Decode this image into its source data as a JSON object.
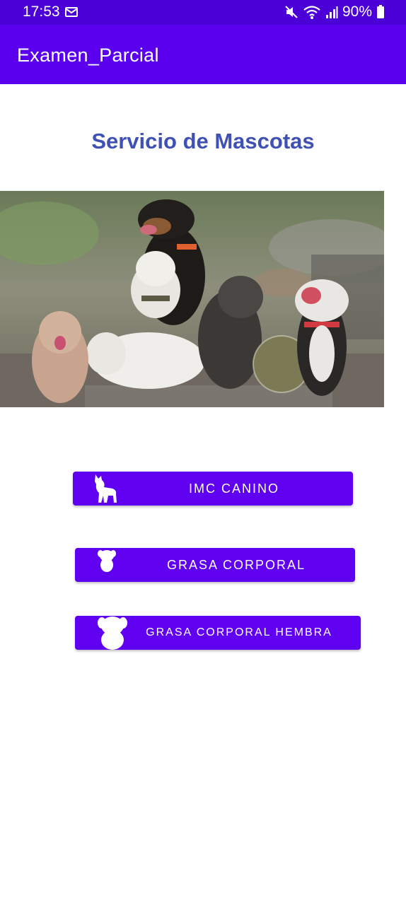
{
  "status_bar": {
    "time": "17:53",
    "battery_percent": "90%",
    "icons": [
      "notification-icon",
      "mute-icon",
      "wifi-icon",
      "signal-icon",
      "battery-icon"
    ]
  },
  "app_bar": {
    "title": "Examen_Parcial"
  },
  "main": {
    "title": "Servicio de Mascotas",
    "hero_image_alt": "dogs-photo",
    "buttons": [
      {
        "label": "IMC CANINO",
        "icon": "dog-silhouette-icon"
      },
      {
        "label": "GRASA CORPORAL",
        "icon": "puppy-silhouette-icon"
      },
      {
        "label": "GRASA CORPORAL HEMBRA",
        "icon": "dog-face-silhouette-icon"
      }
    ]
  },
  "colors": {
    "status_bar": "#4a00d6",
    "app_bar": "#5a00ee",
    "title": "#3f51b5",
    "button": "#6000f0"
  }
}
